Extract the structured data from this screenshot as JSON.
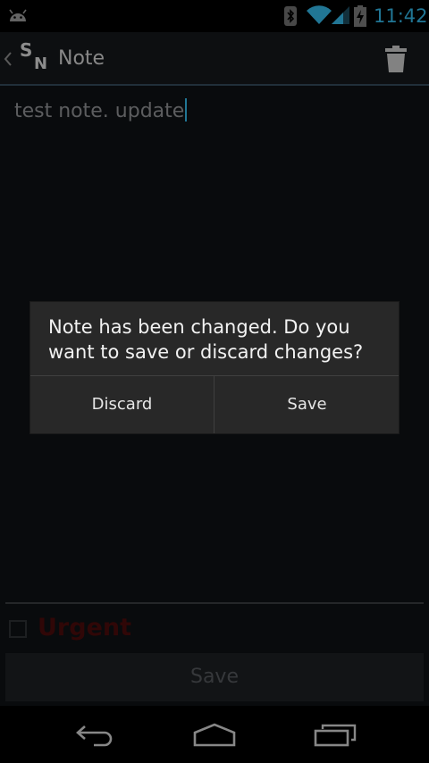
{
  "status_bar": {
    "time": "11:42",
    "icons": [
      "android-icon",
      "bluetooth-icon",
      "wifi-icon",
      "signal-icon",
      "battery-charging-icon"
    ],
    "clock_color": "#33b5e5"
  },
  "action_bar": {
    "logo_letters": {
      "s": "S",
      "n": "N"
    },
    "title": "Note",
    "icons": [
      "chevron-left-icon",
      "trash-icon"
    ]
  },
  "editor": {
    "text": "test note. update",
    "cursor_color": "#33b5e5"
  },
  "urgent": {
    "label": "Urgent",
    "checked": false,
    "label_color": "#4a0c0c"
  },
  "save_bar": {
    "label": "Save"
  },
  "dialog": {
    "message": "Note has been changed. Do you want to save or discard changes?",
    "buttons": {
      "discard": "Discard",
      "save": "Save"
    }
  },
  "nav_bar": {
    "icons": [
      "back-icon",
      "home-icon",
      "recent-apps-icon"
    ]
  }
}
